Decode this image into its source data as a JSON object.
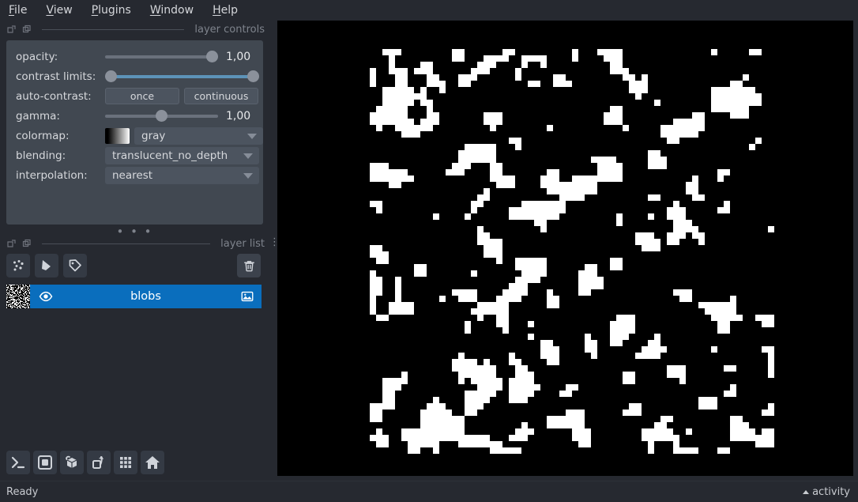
{
  "window": {
    "background": "#262930",
    "panel_background": "#414851",
    "accent": "#0a6ebd"
  },
  "menubar": {
    "items": [
      {
        "label": "File",
        "mnemonic": "F"
      },
      {
        "label": "View",
        "mnemonic": "V"
      },
      {
        "label": "Plugins",
        "mnemonic": "P"
      },
      {
        "label": "Window",
        "mnemonic": "W"
      },
      {
        "label": "Help",
        "mnemonic": "H"
      }
    ]
  },
  "layer_controls": {
    "dock_title": "layer controls",
    "rows": {
      "opacity": {
        "label": "opacity:",
        "value": "1,00",
        "fraction": 1.0
      },
      "contrast_limits": {
        "label": "contrast limits:",
        "low": 0.0,
        "high": 1.0
      },
      "auto_contrast": {
        "label": "auto-contrast:",
        "once": "once",
        "continuous": "continuous"
      },
      "gamma": {
        "label": "gamma:",
        "value": "1,00",
        "fraction": 0.5
      },
      "colormap": {
        "label": "colormap:",
        "value": "gray"
      },
      "blending": {
        "label": "blending:",
        "value": "translucent_no_depth"
      },
      "interpolation": {
        "label": "interpolation:",
        "value": "nearest"
      }
    },
    "resize_dots": "• • •"
  },
  "layer_list": {
    "dock_title": "layer list",
    "buttons": [
      {
        "name": "new-points-layer",
        "tooltip": "New points layer"
      },
      {
        "name": "new-shapes-layer",
        "tooltip": "New shapes layer"
      },
      {
        "name": "new-labels-layer",
        "tooltip": "New labels layer"
      }
    ],
    "delete_button": "delete-layer",
    "layers": [
      {
        "name": "blobs",
        "visible": true,
        "selected": true,
        "type": "image"
      }
    ]
  },
  "viewer_buttons": [
    {
      "name": "console-button",
      "icon": "console-icon"
    },
    {
      "name": "ndisplay-toggle-button",
      "icon": "square-2d-icon"
    },
    {
      "name": "roll-dims-button",
      "icon": "cube-roll-icon"
    },
    {
      "name": "transpose-dims-button",
      "icon": "transpose-icon"
    },
    {
      "name": "grid-view-button",
      "icon": "grid-icon"
    },
    {
      "name": "home-button",
      "icon": "home-icon"
    }
  ],
  "statusbar": {
    "status": "Ready",
    "activity": "activity"
  },
  "canvas": {
    "layer": "blobs",
    "image_background": "#000000",
    "blob_color": "#ffffff",
    "grid_size": 64,
    "volume_fraction": 0.22,
    "seed": 1337
  }
}
